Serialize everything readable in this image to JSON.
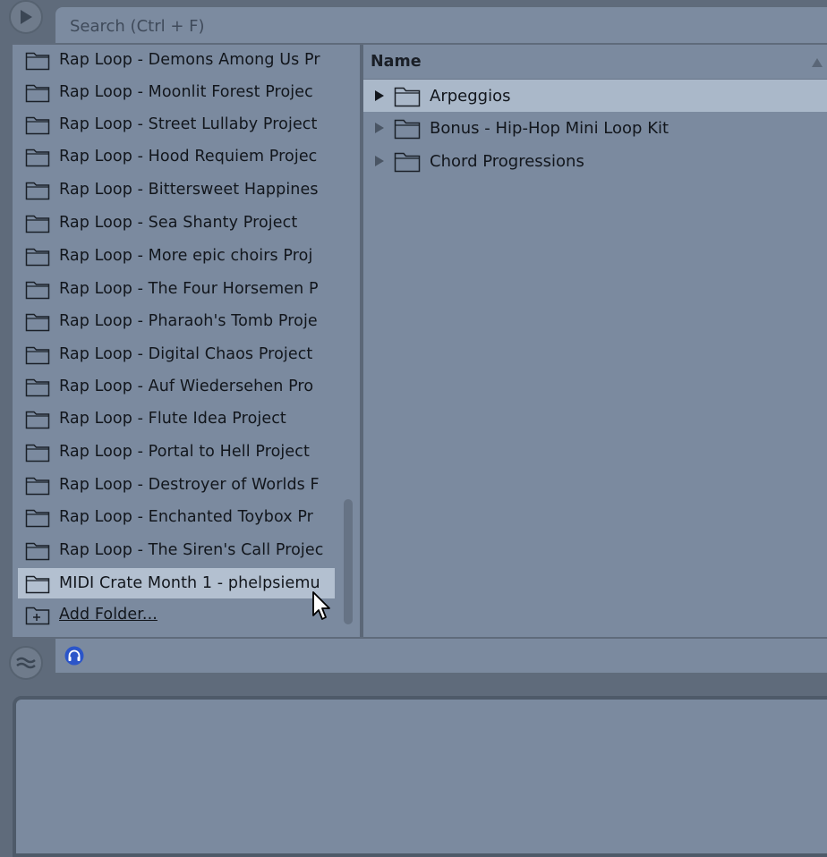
{
  "search": {
    "placeholder": "Search (Ctrl + F)"
  },
  "places": {
    "items": [
      {
        "label": "Rap Loop - Demons Among Us Pr"
      },
      {
        "label": "Rap Loop - Moonlit Forest Projec"
      },
      {
        "label": "Rap Loop - Street Lullaby Project"
      },
      {
        "label": "Rap Loop - Hood Requiem Projec"
      },
      {
        "label": "Rap Loop - Bittersweet Happines"
      },
      {
        "label": "Rap Loop - Sea Shanty Project"
      },
      {
        "label": "Rap Loop - More epic choirs Proj"
      },
      {
        "label": "Rap Loop - The Four Horsemen P"
      },
      {
        "label": "Rap Loop - Pharaoh's Tomb Proje"
      },
      {
        "label": "Rap Loop - Digital Chaos Project"
      },
      {
        "label": "Rap Loop - Auf Wiedersehen Pro"
      },
      {
        "label": "Rap Loop - Flute Idea Project"
      },
      {
        "label": "Rap Loop - Portal to Hell Project"
      },
      {
        "label": "Rap Loop - Destroyer of Worlds F"
      },
      {
        "label": "Rap Loop - Enchanted Toybox Pr"
      },
      {
        "label": "Rap Loop - The Siren's Call Projec"
      },
      {
        "label": "MIDI Crate Month 1 - phelpsiemu"
      }
    ],
    "add_folder_label": "Add Folder..."
  },
  "content": {
    "header_label": "Name",
    "items": [
      {
        "label": "Arpeggios"
      },
      {
        "label": "Bonus - Hip-Hop Mini Loop Kit"
      },
      {
        "label": "Chord Progressions"
      }
    ]
  },
  "colors": {
    "background": "#5f6b7b",
    "panel": "#7b8a9f",
    "selection": "#b3c0d0",
    "accent": "#2b55c9"
  },
  "icons": {
    "top_left": "play-triangle-icon",
    "groove": "waveform-icon",
    "headphones": "headphones-icon",
    "folder": "folder-icon",
    "add": "add-folder-icon",
    "sort": "sort-ascending-icon",
    "cursor": "mouse-pointer-icon"
  }
}
